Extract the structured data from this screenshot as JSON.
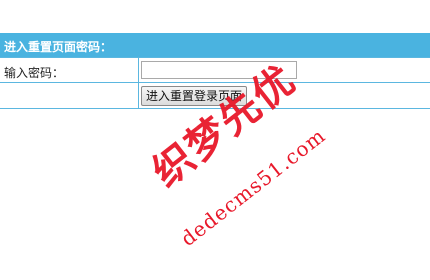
{
  "form": {
    "header_title": "进入重置页面密码：",
    "password_label": "输入密码：",
    "password_value": "",
    "submit_label": "进入重置登录页面"
  },
  "watermark": {
    "brand_text": "织梦先优",
    "url_text": "dedecms51.com"
  },
  "colors": {
    "header_bg": "#4ab3e0",
    "border": "#5bb7e0",
    "watermark": "#e8182a"
  }
}
